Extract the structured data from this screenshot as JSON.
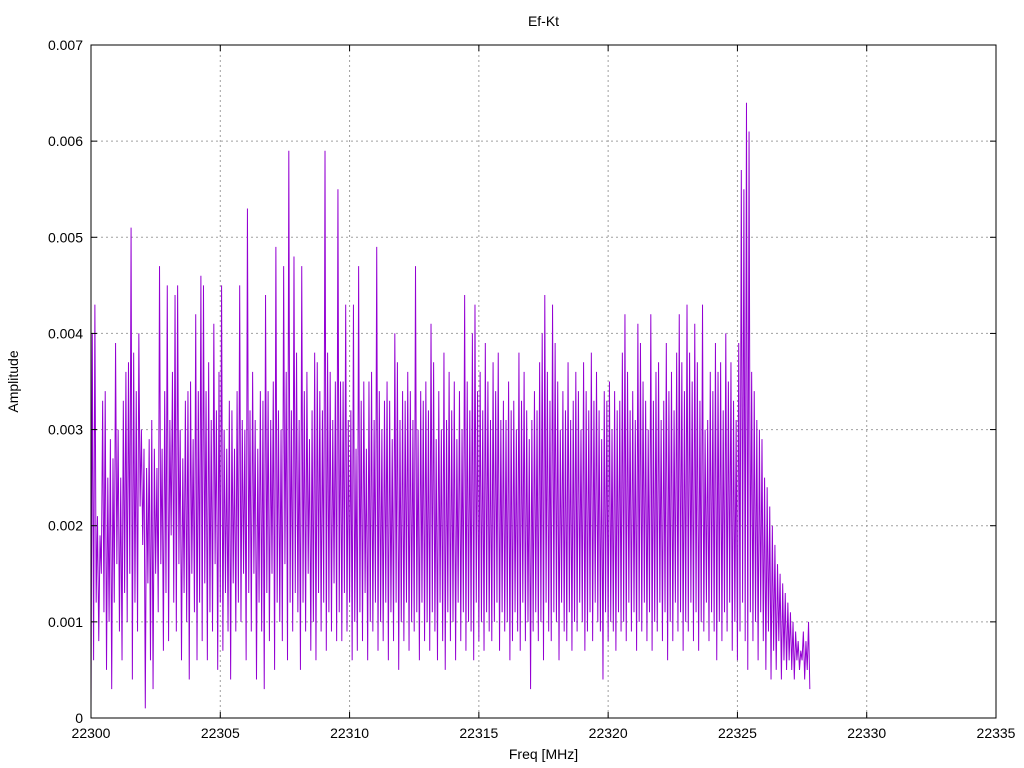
{
  "chart_data": {
    "type": "line",
    "title": "Ef-Kt",
    "xlabel": "Freq [MHz]",
    "ylabel": "Amplitude",
    "xlim": [
      22300,
      22335
    ],
    "ylim": [
      0,
      0.007
    ],
    "xticks": [
      22300,
      22305,
      22310,
      22315,
      22320,
      22325,
      22330,
      22335
    ],
    "xtick_labels": [
      "22300",
      "22305",
      "22310",
      "22315",
      "22320",
      "22325",
      "22330",
      "22335"
    ],
    "yticks": [
      0,
      0.001,
      0.002,
      0.003,
      0.004,
      0.005,
      0.006,
      0.007
    ],
    "ytick_labels": [
      "0",
      "0.001",
      "0.002",
      "0.003",
      "0.004",
      "0.005",
      "0.006",
      "0.007"
    ],
    "grid": true,
    "series": [
      {
        "color": "#9400d3",
        "x_start": 22300,
        "x_step": 0.05,
        "y": [
          0.0001,
          0.004,
          0.0006,
          0.0043,
          0.0012,
          0.0021,
          0.0008,
          0.0019,
          0.0015,
          0.0033,
          0.0011,
          0.0034,
          0.0005,
          0.0025,
          0.001,
          0.0029,
          0.0003,
          0.0027,
          0.0012,
          0.0039,
          0.0016,
          0.003,
          0.0009,
          0.0025,
          0.0006,
          0.0033,
          0.0013,
          0.0036,
          0.001,
          0.0037,
          0.0015,
          0.0051,
          0.0004,
          0.0038,
          0.0012,
          0.0034,
          0.0009,
          0.004,
          0.0022,
          0.003,
          0.0018,
          0.0028,
          0.0001,
          0.0026,
          0.0014,
          0.0029,
          0.0006,
          0.0031,
          0.0003,
          0.0028,
          0.0015,
          0.0026,
          0.0011,
          0.0047,
          0.0016,
          0.0028,
          0.0007,
          0.0034,
          0.0013,
          0.0045,
          0.0008,
          0.0031,
          0.0019,
          0.0036,
          0.0012,
          0.0044,
          0.0009,
          0.0045,
          0.0016,
          0.003,
          0.0006,
          0.0027,
          0.0013,
          0.0033,
          0.001,
          0.0034,
          0.0004,
          0.0035,
          0.0015,
          0.0029,
          0.0011,
          0.0042,
          0.0006,
          0.0034,
          0.0012,
          0.0046,
          0.0008,
          0.0045,
          0.0014,
          0.0034,
          0.0006,
          0.0037,
          0.0011,
          0.0031,
          0.0009,
          0.0041,
          0.0016,
          0.0032,
          0.0005,
          0.0036,
          0.0012,
          0.0045,
          0.0007,
          0.003,
          0.0013,
          0.0028,
          0.0009,
          0.0033,
          0.0004,
          0.0032,
          0.0014,
          0.0028,
          0.0009,
          0.0034,
          0.0012,
          0.0045,
          0.001,
          0.0031,
          0.0015,
          0.003,
          0.0006,
          0.0053,
          0.0013,
          0.0032,
          0.0009,
          0.0036,
          0.0015,
          0.0031,
          0.0004,
          0.0028,
          0.0012,
          0.0034,
          0.0009,
          0.0033,
          0.0003,
          0.0044,
          0.0013,
          0.0034,
          0.0008,
          0.0031,
          0.0015,
          0.0035,
          0.0005,
          0.0049,
          0.0012,
          0.0032,
          0.001,
          0.003,
          0.0008,
          0.0047,
          0.0016,
          0.0036,
          0.0006,
          0.0059,
          0.0012,
          0.0032,
          0.0009,
          0.0048,
          0.0013,
          0.0038,
          0.0011,
          0.0031,
          0.0005,
          0.0047,
          0.0012,
          0.0034,
          0.0009,
          0.0036,
          0.0015,
          0.0029,
          0.0007,
          0.0032,
          0.001,
          0.0038,
          0.0006,
          0.0037,
          0.0013,
          0.0034,
          0.0009,
          0.0032,
          0.0012,
          0.0059,
          0.0007,
          0.0038,
          0.0011,
          0.0036,
          0.0009,
          0.0031,
          0.0014,
          0.0035,
          0.0008,
          0.0055,
          0.0011,
          0.0035,
          0.0008,
          0.0035,
          0.0013,
          0.0043,
          0.0009,
          0.0031,
          0.0012,
          0.0032,
          0.0006,
          0.0043,
          0.001,
          0.0028,
          0.0007,
          0.0047,
          0.0011,
          0.0033,
          0.0008,
          0.0035,
          0.0013,
          0.0028,
          0.0006,
          0.0035,
          0.001,
          0.0036,
          0.0009,
          0.0031,
          0.0012,
          0.0049,
          0.0007,
          0.0034,
          0.001,
          0.003,
          0.0008,
          0.0033,
          0.0012,
          0.0035,
          0.0006,
          0.0033,
          0.0011,
          0.0029,
          0.0008,
          0.004,
          0.0012,
          0.0037,
          0.0005,
          0.0031,
          0.001,
          0.0034,
          0.0008,
          0.0033,
          0.0012,
          0.0036,
          0.0007,
          0.0034,
          0.001,
          0.0031,
          0.0009,
          0.0047,
          0.0011,
          0.003,
          0.0006,
          0.0034,
          0.0012,
          0.0033,
          0.0008,
          0.0035,
          0.001,
          0.0032,
          0.0007,
          0.0041,
          0.0011,
          0.0037,
          0.0009,
          0.0029,
          0.0006,
          0.0034,
          0.0012,
          0.003,
          0.0008,
          0.0038,
          0.0005,
          0.0031,
          0.0011,
          0.0036,
          0.0008,
          0.0032,
          0.001,
          0.0035,
          0.0006,
          0.0029,
          0.0012,
          0.0034,
          0.0008,
          0.003,
          0.0011,
          0.0044,
          0.0007,
          0.0035,
          0.001,
          0.0032,
          0.0009,
          0.004,
          0.0006,
          0.0043,
          0.0012,
          0.0034,
          0.0008,
          0.0036,
          0.001,
          0.0032,
          0.0007,
          0.0039,
          0.0011,
          0.0035,
          0.0009,
          0.0031,
          0.0008,
          0.0037,
          0.001,
          0.0034,
          0.0012,
          0.0038,
          0.0007,
          0.0031,
          0.0011,
          0.0033,
          0.0009,
          0.0031,
          0.001,
          0.0035,
          0.0006,
          0.0032,
          0.0008,
          0.0033,
          0.0011,
          0.003,
          0.0009,
          0.0038,
          0.0007,
          0.0033,
          0.0012,
          0.0036,
          0.0008,
          0.0032,
          0.001,
          0.0029,
          0.0003,
          0.0031,
          0.0009,
          0.0034,
          0.0011,
          0.0032,
          0.0008,
          0.0037,
          0.001,
          0.004,
          0.0006,
          0.0044,
          0.0012,
          0.0036,
          0.0009,
          0.0033,
          0.0008,
          0.0043,
          0.0011,
          0.0039,
          0.001,
          0.0035,
          0.0006,
          0.003,
          0.0012,
          0.0034,
          0.0009,
          0.0032,
          0.0008,
          0.0037,
          0.0011,
          0.0031,
          0.0007,
          0.0033,
          0.001,
          0.0036,
          0.0009,
          0.0034,
          0.0012,
          0.003,
          0.001,
          0.0037,
          0.0007,
          0.0034,
          0.0009,
          0.0032,
          0.0011,
          0.0038,
          0.0008,
          0.0033,
          0.0012,
          0.0036,
          0.001,
          0.0032,
          0.0009,
          0.0029,
          0.0004,
          0.0034,
          0.0011,
          0.0033,
          0.0008,
          0.0035,
          0.001,
          0.003,
          0.0009,
          0.0034,
          0.0007,
          0.0032,
          0.0011,
          0.0033,
          0.0009,
          0.0038,
          0.001,
          0.0042,
          0.0008,
          0.0036,
          0.0012,
          0.0032,
          0.0009,
          0.0034,
          0.0011,
          0.0031,
          0.0007,
          0.0041,
          0.001,
          0.0039,
          0.0009,
          0.0035,
          0.0012,
          0.0033,
          0.0008,
          0.003,
          0.0011,
          0.0042,
          0.0007,
          0.0033,
          0.001,
          0.0036,
          0.0009,
          0.0037,
          0.0012,
          0.0031,
          0.0008,
          0.0033,
          0.0011,
          0.0039,
          0.0006,
          0.0034,
          0.001,
          0.0036,
          0.0008,
          0.0032,
          0.0012,
          0.0038,
          0.0009,
          0.0042,
          0.0011,
          0.0037,
          0.0007,
          0.0034,
          0.001,
          0.0043,
          0.0009,
          0.0038,
          0.0012,
          0.0035,
          0.0008,
          0.0041,
          0.0011,
          0.0037,
          0.0007,
          0.0033,
          0.001,
          0.0043,
          0.0009,
          0.003,
          0.0012,
          0.0031,
          0.0008,
          0.0036,
          0.0011,
          0.0034,
          0.0009,
          0.0039,
          0.0006,
          0.0036,
          0.001,
          0.0037,
          0.0008,
          0.0032,
          0.0011,
          0.004,
          0.0009,
          0.0035,
          0.0012,
          0.0037,
          0.0007,
          0.0033,
          0.001,
          0.0031,
          0.0006,
          0.0039,
          0.0009,
          0.0057,
          0.0012,
          0.0055,
          0.0008,
          0.0064,
          0.0005,
          0.0061,
          0.0011,
          0.0036,
          0.0008,
          0.0034,
          0.001,
          0.0031,
          0.0006,
          0.003,
          0.0011,
          0.0029,
          0.0008,
          0.0025,
          0.0005,
          0.0024,
          0.0009,
          0.0022,
          0.0004,
          0.002,
          0.0007,
          0.0018,
          0.0005,
          0.0016,
          0.0008,
          0.0015,
          0.0004,
          0.0014,
          0.0006,
          0.0013,
          0.0005,
          0.0012,
          0.0006,
          0.0011,
          0.0005,
          0.001,
          0.0004,
          0.0009,
          0.0006,
          0.0008,
          0.0005,
          0.0007,
          0.0006,
          0.0009,
          0.0004,
          0.0008,
          0.0005,
          0.001,
          0.0003
        ]
      }
    ]
  }
}
